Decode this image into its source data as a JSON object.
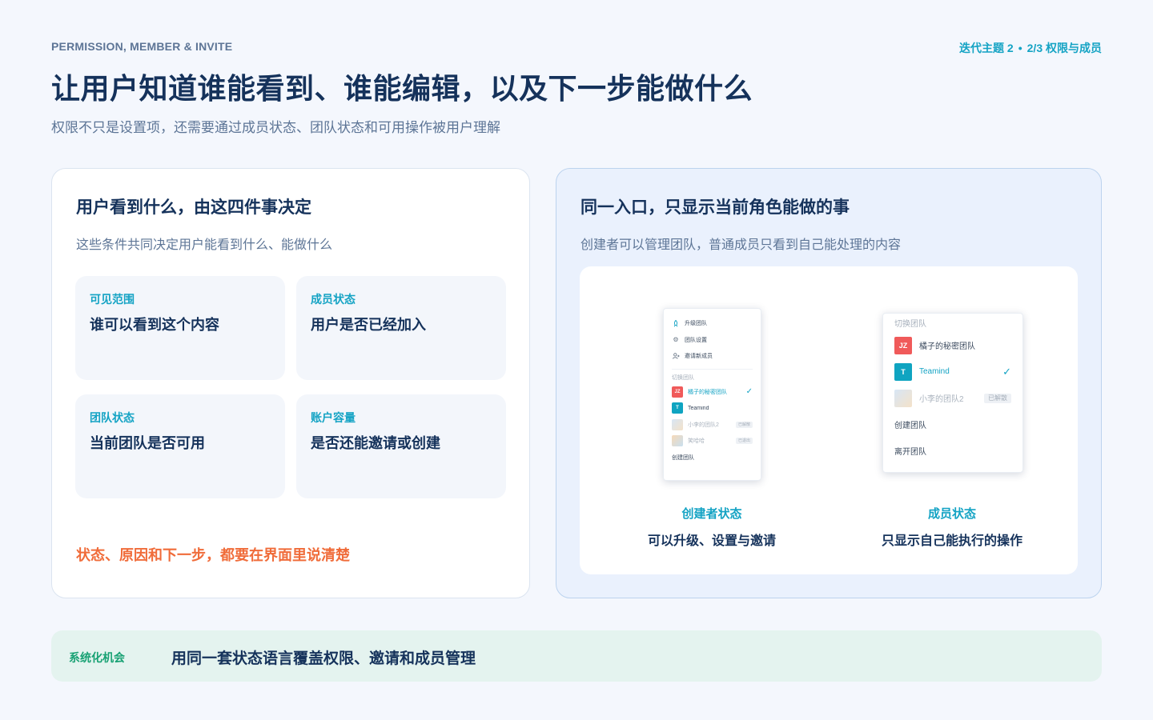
{
  "header": {
    "eyebrow": "PERMISSION, MEMBER & INVITE",
    "iteration_theme": "迭代主题 2",
    "iteration_dot": "•",
    "iteration_page": "2/3 权限与成员",
    "title": "让用户知道谁能看到、谁能编辑，以及下一步能做什么",
    "subtitle": "权限不只是设置项，还需要通过成员状态、团队状态和可用操作被用户理解"
  },
  "left_card": {
    "title": "用户看到什么，由这四件事决定",
    "description": "这些条件共同决定用户能看到什么、能做什么",
    "factors": [
      {
        "label": "可见范围",
        "value": "谁可以看到这个内容"
      },
      {
        "label": "成员状态",
        "value": "用户是否已经加入"
      },
      {
        "label": "团队状态",
        "value": "当前团队是否可用"
      },
      {
        "label": "账户容量",
        "value": "是否还能邀请或创建"
      }
    ],
    "callout": "状态、原因和下一步，都要在界面里说清楚"
  },
  "right_card": {
    "title": "同一入口，只显示当前角色能做的事",
    "description": "创建者可以管理团队，普通成员只看到自己能处理的内容",
    "creator_menu": {
      "actions": [
        {
          "icon": "rocket-icon",
          "label": "升级团队"
        },
        {
          "icon": "gear-icon",
          "label": "团队设置"
        },
        {
          "icon": "add-user-icon",
          "label": "邀请新成员"
        }
      ],
      "section_label": "切换团队",
      "teams": [
        {
          "avatar": "JZ",
          "label": "橘子的秘密团队",
          "selected": true
        },
        {
          "avatar": "T",
          "label": "Teamind"
        },
        {
          "label": "小李的团队2",
          "tag": "已解散"
        },
        {
          "label": "笑哈哈",
          "tag": "已退出"
        }
      ],
      "create_label": "创建团队"
    },
    "member_menu": {
      "section_label": "切换团队",
      "teams": [
        {
          "avatar": "JZ",
          "label": "橘子的秘密团队"
        },
        {
          "avatar": "T",
          "label": "Teamind",
          "selected": true
        },
        {
          "label": "小李的团队2",
          "tag": "已解散"
        }
      ],
      "create_label": "创建团队",
      "leave_label": "离开团队"
    },
    "roles": [
      {
        "label": "创建者状态",
        "description": "可以升级、设置与邀请"
      },
      {
        "label": "成员状态",
        "description": "只显示自己能执行的操作"
      }
    ]
  },
  "banner": {
    "tag": "系统化机会",
    "text": "用同一套状态语言覆盖权限、邀请和成员管理"
  },
  "colors": {
    "primary_text": "#15325b",
    "accent_teal": "#14a3c4",
    "accent_orange": "#f06c3a",
    "accent_green": "#17a173",
    "avatar_red": "#f05a5a"
  }
}
